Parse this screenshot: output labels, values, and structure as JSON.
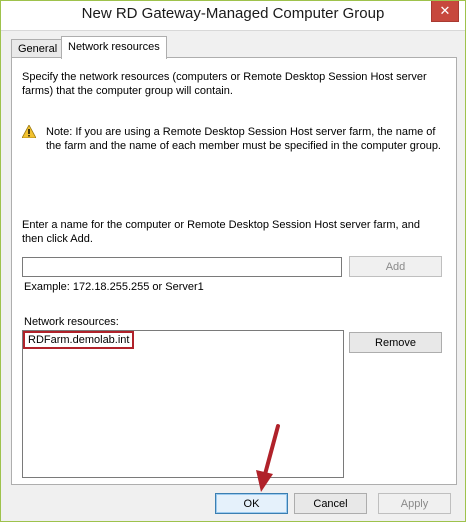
{
  "window": {
    "title": "New RD Gateway-Managed Computer Group"
  },
  "title_bar": {
    "close_glyph": "✕"
  },
  "tabs": [
    {
      "label": "General"
    },
    {
      "label": "Network resources"
    }
  ],
  "content": {
    "intro_line1": "Specify the network resources (computers or Remote Desktop Session Host server",
    "intro_line2": "farms) that the computer group will contain.",
    "note_line1": "Note: If you are using a Remote Desktop Session Host server farm, the name of",
    "note_line2": "the farm and the name of each member must be specified in the computer group.",
    "enter_line1": "Enter a name for the computer or Remote Desktop Session Host server farm, and",
    "enter_line2": "then click Add.",
    "name_input_value": "",
    "add_label": "Add",
    "example_text": "Example: 172.18.255.255 or Server1",
    "resources_label": "Network resources:",
    "resources": [
      "RDFarm.demolab.int"
    ],
    "remove_label": "Remove"
  },
  "footer": {
    "ok_label": "OK",
    "cancel_label": "Cancel",
    "apply_label": "Apply"
  },
  "colors": {
    "highlight_box": "#b0222a",
    "arrow": "#b0222a",
    "close_button": "#c7483d"
  }
}
